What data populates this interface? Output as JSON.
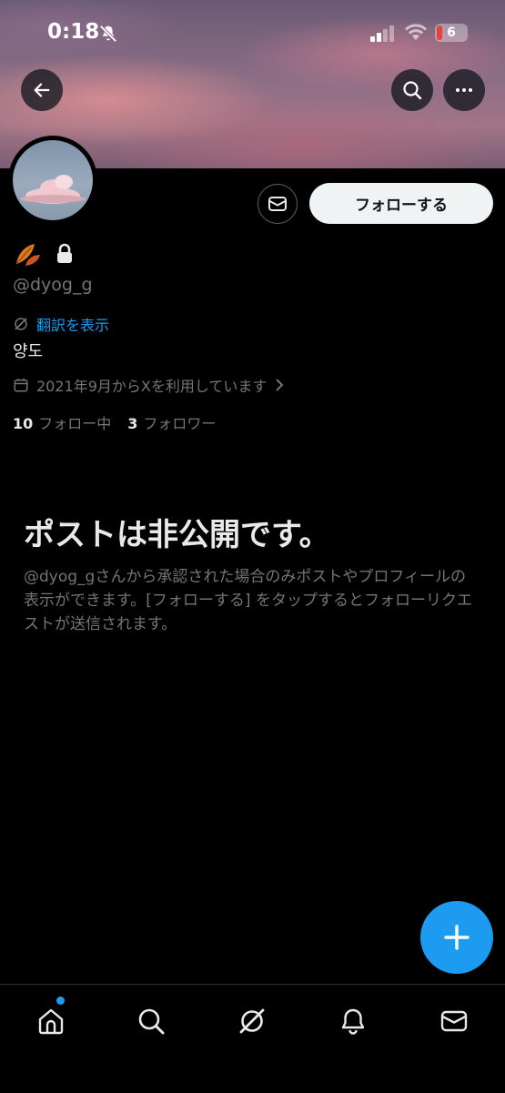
{
  "status_bar": {
    "time": "0:18",
    "battery": "6"
  },
  "profile": {
    "handle": "@dyog_g",
    "translate_label": "翻訳を表示",
    "bio": "양도",
    "joined": "2021年9月からXを利用しています",
    "following_count": "10",
    "following_label": "フォロー中",
    "followers_count": "3",
    "followers_label": "フォロワー"
  },
  "actions": {
    "follow_label": "フォローする"
  },
  "private_notice": {
    "title": "ポストは非公開です。",
    "description": "@dyog_gさんから承認された場合のみポストやプロフィールの表示ができます。[フォローする] をタップするとフォローリクエストが送信されます。"
  },
  "tabs": [
    "home",
    "search",
    "grok",
    "notifications",
    "messages"
  ],
  "colors": {
    "accent": "#1d9bf0",
    "background": "#000000",
    "secondary_text": "#71767b"
  }
}
